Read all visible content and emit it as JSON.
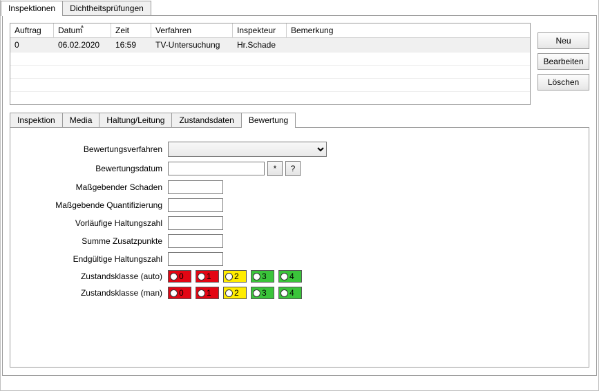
{
  "topTabs": {
    "inspektionen": "Inspektionen",
    "dicht": "Dichtheitsprüfungen"
  },
  "table": {
    "headers": {
      "auftrag": "Auftrag",
      "datum": "Datum",
      "zeit": "Zeit",
      "verfahren": "Verfahren",
      "inspekteur": "Inspekteur",
      "bemerkung": "Bemerkung"
    },
    "row0": {
      "auftrag": "0",
      "datum": "06.02.2020",
      "zeit": "16:59",
      "verfahren": "TV-Untersuchung",
      "inspekteur": "Hr.Schade",
      "bemerkung": ""
    }
  },
  "buttons": {
    "neu": "Neu",
    "bearbeiten": "Bearbeiten",
    "loeschen": "Löschen"
  },
  "innerTabs": {
    "inspektion": "Inspektion",
    "media": "Media",
    "haltung": "Haltung/Leitung",
    "zustand": "Zustandsdaten",
    "bewertung": "Bewertung"
  },
  "form": {
    "bewertungsverfahren_label": "Bewertungsverfahren",
    "bewertungsdatum_label": "Bewertungsdatum",
    "mass_schaden_label": "Maßgebender Schaden",
    "mass_quant_label": "Maßgebende Quantifizierung",
    "vorl_halt_label": "Vorläufige Haltungszahl",
    "summe_label": "Summe Zusatzpunkte",
    "endg_label": "Endgültige Haltungszahl",
    "zk_auto_label": "Zustandsklasse (auto)",
    "zk_man_label": "Zustandsklasse (man)",
    "star": "*",
    "qm": "?",
    "bewertungsverfahren_value": "",
    "bewertungsdatum_value": "",
    "mass_schaden_value": "",
    "mass_quant_value": "",
    "vorl_halt_value": "",
    "summe_value": "",
    "endg_value": ""
  },
  "zk": {
    "v0": "0",
    "v1": "1",
    "v2": "2",
    "v3": "3",
    "v4": "4"
  }
}
